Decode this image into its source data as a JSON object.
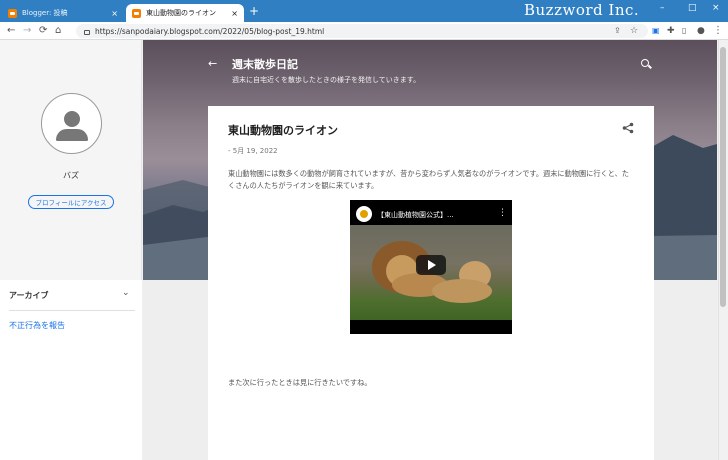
{
  "browser": {
    "tabs": [
      {
        "title": "Blogger: 投稿",
        "active": false
      },
      {
        "title": "東山動物園のライオン",
        "active": true
      }
    ],
    "new_tab": "+",
    "brand": "Buzzword Inc.",
    "window_controls": {
      "minimize": "–",
      "maximize": "□",
      "close": "×"
    },
    "url": "https://sanpodaiary.blogspot.com/2022/05/blog-post_19.html",
    "nav_icons": {
      "back": "←",
      "forward": "→",
      "reload": "⟳",
      "home": "⌂"
    }
  },
  "sidebar": {
    "profile_name": "バズ",
    "profile_button": "プロフィールにアクセス",
    "archive_label": "アーカイブ",
    "archive_chevron": "⌄",
    "report_link": "不正行為を報告"
  },
  "header": {
    "back_arrow": "←",
    "title": "週末散歩日記",
    "description": "週末に自宅近くを散歩したときの様子を発信していきます。"
  },
  "post": {
    "title": "東山動物園のライオン",
    "date": "- 5月 19, 2022",
    "body": "東山動物園には数多くの動物が飼育されていますが、昔から変わらず人気者なのがライオンです。週末に動物園に行くと、たくさんの人たちがライオンを観に来ています。",
    "video_title": "【東山動植物園公式】...",
    "video_more": "⋮",
    "closing": "また次に行ったときは見に行きたいですね。"
  },
  "colors": {
    "tab_bar": "#2f7fc2",
    "link": "#1a73e8",
    "card": "#ffffff"
  }
}
